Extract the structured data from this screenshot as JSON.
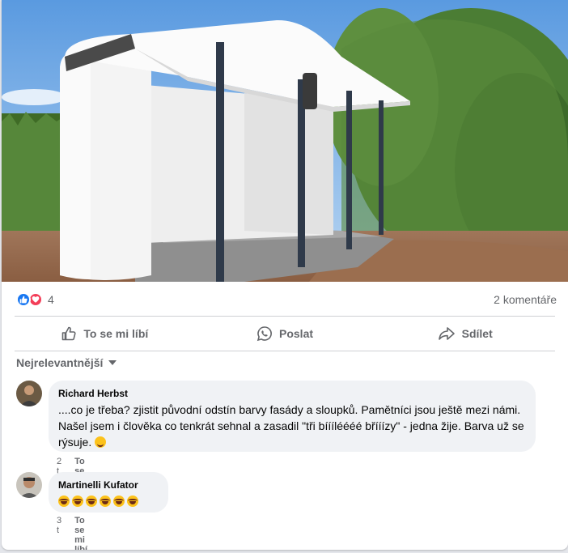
{
  "post": {
    "reaction_count": "4",
    "comments_count": "2 komentáře"
  },
  "actions": {
    "like": "To se mi líbí",
    "send": "Poslat",
    "share": "Sdílet"
  },
  "sort": {
    "label": "Nejrelevantnější"
  },
  "comments": [
    {
      "author": "Richard Herbst",
      "text": "....co je třeba? zjistit původní odstín barvy fasády a sloupků. Pamětníci jsou ještě mezi námi. Našel jsem i člověka co tenkrát sehnal a zasadil \"tři bíííléééé břííízy\" - jedna žije. Barva už se rýsuje.",
      "emoji": "wink",
      "time": "2 t",
      "like": "To se mi líbí"
    },
    {
      "author": "Martinelli Kufator",
      "emoji": "laugh",
      "emoji_count": 6,
      "time": "3 t",
      "like": "To se mi líbí"
    }
  ],
  "colors": {
    "accent": "#1877f2",
    "love": "#f33e58",
    "secondary_text": "#65676b",
    "bubble": "#f0f2f5"
  },
  "icons": [
    "like-reaction-icon",
    "love-reaction-icon",
    "thumbs-up-icon",
    "whatsapp-icon",
    "share-arrow-icon",
    "caret-down-icon"
  ]
}
